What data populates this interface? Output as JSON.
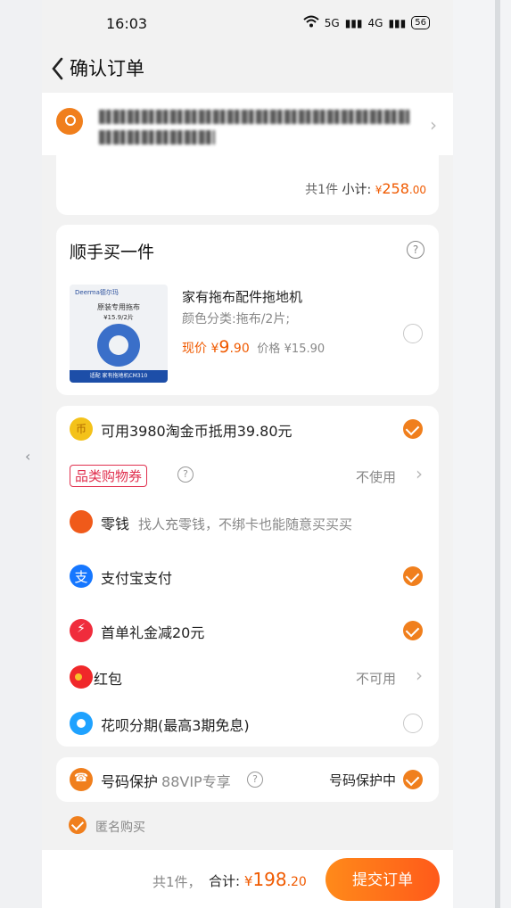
{
  "status_bar": {
    "time": "16:03",
    "signal1": "5G",
    "signal2": "4G",
    "battery": "56"
  },
  "header": {
    "title": "确认订单"
  },
  "subtotal": {
    "count": "共1件",
    "label": "小计:",
    "currency": "¥",
    "amount_int": "258",
    "amount_dec": ".00"
  },
  "add_on": {
    "title": "顺手买一件",
    "help": "?",
    "image_brand": "Deerma德尔玛",
    "image_title": "原装专用拖布",
    "image_price": "¥15.9/2片",
    "image_footer": "适配 家有拖地机CM310",
    "product_name": "家有拖布配件拖地机",
    "variant": "颜色分类:拖布/2片;",
    "now_label": "现价",
    "currency": "¥",
    "now_int": "9",
    "now_dec": ".90",
    "orig_label": "价格",
    "orig_price": "¥15.90"
  },
  "payment": {
    "coins": "可用3980淘金币抵用39.80元",
    "coupon_tag": "品类购物券",
    "help": "?",
    "coupon_state": "不使用",
    "change_label": "零钱",
    "change_hint": "找人充零钱，不绑卡也能随意买买买",
    "alipay": "支付宝支付",
    "first_order": "首单礼金减20元",
    "red_packet": "红包",
    "red_packet_state": "不可用",
    "huabei": "花呗分期(最高3期免息)"
  },
  "protection": {
    "label": "号码保护",
    "vip": "88VIP专享",
    "help": "?",
    "state": "号码保护中"
  },
  "anonymous": {
    "label": "匿名购买"
  },
  "footer": {
    "count": "共1件，",
    "total_label": "合计:",
    "currency": "¥",
    "total_int": "198",
    "total_dec": ".20",
    "submit": "提交订单"
  },
  "colors": {
    "accent": "#f07f1d",
    "price": "#f05a00",
    "alipay": "#1677ff"
  },
  "icons": [
    "back-icon",
    "location-pin-icon",
    "chevron-right-icon",
    "help-icon",
    "taobao-coin-icon",
    "coupon-icon",
    "wallet-icon",
    "alipay-icon",
    "gift-icon",
    "red-packet-icon",
    "huabei-icon",
    "phone-protect-icon",
    "check-icon"
  ]
}
